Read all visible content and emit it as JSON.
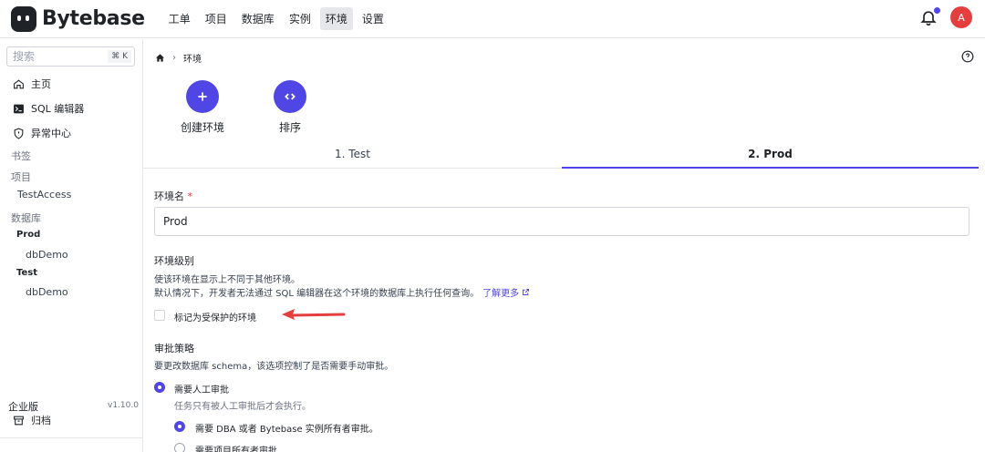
{
  "header": {
    "app_name": "Bytebase",
    "nav": [
      "工单",
      "项目",
      "数据库",
      "实例",
      "环境",
      "设置"
    ],
    "active_nav": "环境",
    "avatar_initial": "A",
    "accent_color": "#4f46e5"
  },
  "sidebar": {
    "search_placeholder": "搜索",
    "search_shortcut": "⌘ K",
    "items": [
      {
        "label": "主页",
        "icon": "home-icon"
      },
      {
        "label": "SQL 编辑器",
        "icon": "terminal-icon"
      },
      {
        "label": "异常中心",
        "icon": "shield-icon"
      }
    ],
    "bookmarks_label": "书签",
    "projects_label": "项目",
    "projects": [
      "TestAccess"
    ],
    "databases_label": "数据库",
    "db_groups": [
      {
        "env": "Prod",
        "dbs": [
          "dbDemo"
        ]
      },
      {
        "env": "Test",
        "dbs": [
          "dbDemo"
        ]
      }
    ],
    "archive_label": "归档",
    "edition": "企业版",
    "version": "v1.10.0"
  },
  "main": {
    "breadcrumb": {
      "current": "环境"
    },
    "actions": [
      {
        "label": "创建环境",
        "icon": "plus-icon"
      },
      {
        "label": "排序",
        "icon": "code-icon"
      }
    ],
    "tabs": [
      {
        "label": "1. Test"
      },
      {
        "label": "2. Prod"
      }
    ],
    "active_tab": "2. Prod",
    "form": {
      "name_label": "环境名",
      "required_mark": "*",
      "name_value": "Prod",
      "tier_label": "环境级别",
      "tier_desc1": "使该环境在显示上不同于其他环境。",
      "tier_desc2": "默认情况下，开发者无法通过 SQL 编辑器在这个环境的数据库上执行任何查询。",
      "learn_more": "了解更多",
      "protected_label": "标记为受保护的环境",
      "protected_checked": false,
      "approval_label": "审批策略",
      "approval_desc": "要更改数据库 schema，该选项控制了是否需要手动审批。",
      "manual_label": "需要人工审批",
      "manual_desc": "任务只有被人工审批后才会执行。",
      "dba_label": "需要 DBA 或者 Bytebase 实例所有者审批。",
      "owner_label": "需要项目所有者审批"
    }
  }
}
